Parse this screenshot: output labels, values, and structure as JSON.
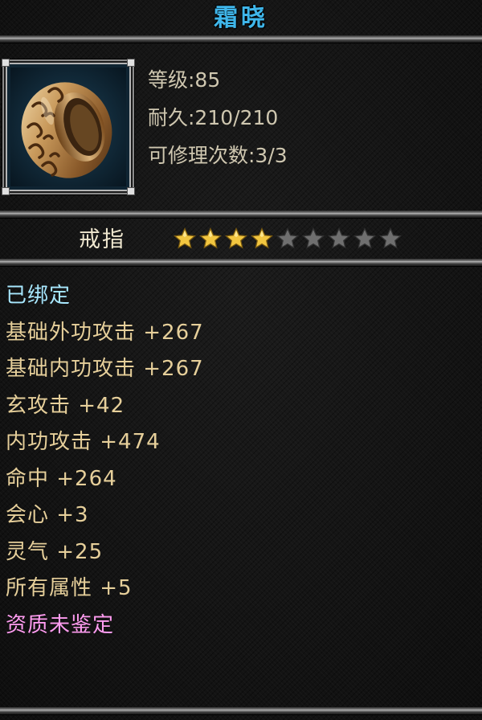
{
  "item": {
    "name": "霜晓",
    "icon": "ring-icon",
    "level": "等级:85",
    "durability": "耐久:210/210",
    "repair_count": "可修理次数:3/3",
    "type": "戒指",
    "rating": {
      "value": 4,
      "max": 9
    }
  },
  "attributes": {
    "bound": "已绑定",
    "stats": [
      "基础外功攻击 +267",
      "基础内功攻击 +267",
      "玄攻击 +42",
      "内功攻击 +474",
      "命中 +264",
      "会心 +3",
      "灵气 +25",
      "所有属性 +5"
    ],
    "quality": "资质未鉴定"
  },
  "colors": {
    "name": "#3fb6ea",
    "bound": "#a8e8ff",
    "stat": "#e6cf9a",
    "quality": "#ff9cf0",
    "star_filled": "#f2c640",
    "star_empty": "#6f6f6f"
  }
}
